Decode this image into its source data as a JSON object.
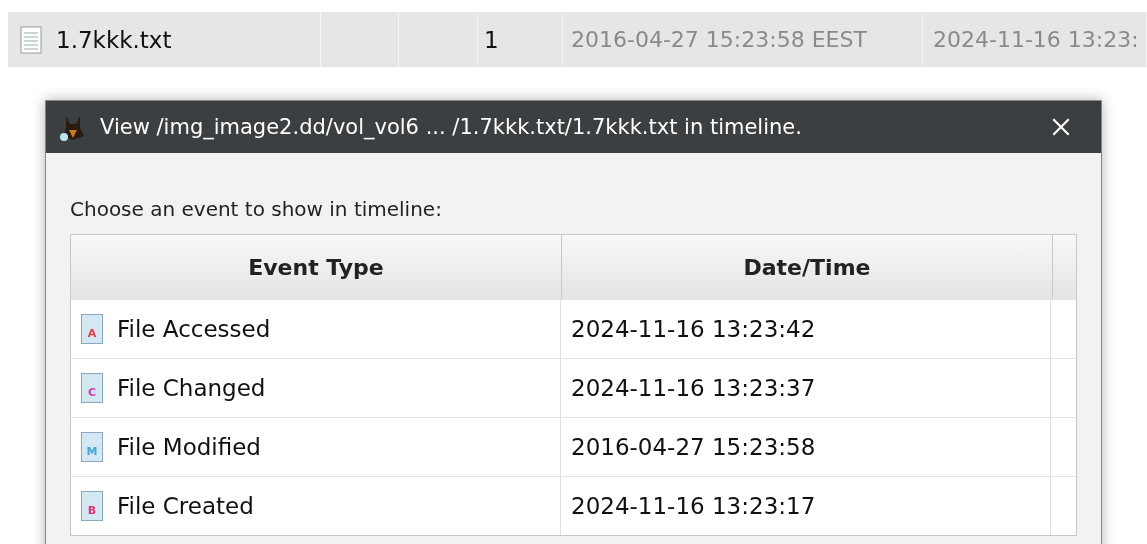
{
  "file_row": {
    "name": "1.7kkk.txt",
    "count": "1",
    "modified": "2016-04-27 15:23:58 EEST",
    "column_6": "2024-11-16 13:23:"
  },
  "dialog": {
    "title": "View /img_image2.dd/vol_vol6 ... /1.7kkk.txt/1.7kkk.txt in timeline.",
    "prompt": "Choose an event to show in timeline:",
    "columns": [
      "Event Type",
      "Date/Time"
    ],
    "rows": [
      {
        "letter": "A",
        "color": "#e0404a",
        "event": "File Accessed",
        "time": "2024-11-16 13:23:42"
      },
      {
        "letter": "C",
        "color": "#d040b0",
        "event": "File Changed",
        "time": "2024-11-16 13:23:37"
      },
      {
        "letter": "M",
        "color": "#40a8d8",
        "event": "File Modified",
        "time": "2016-04-27 15:23:58"
      },
      {
        "letter": "B",
        "color": "#e03070",
        "event": "File Created",
        "time": "2024-11-16 13:23:17"
      }
    ]
  }
}
